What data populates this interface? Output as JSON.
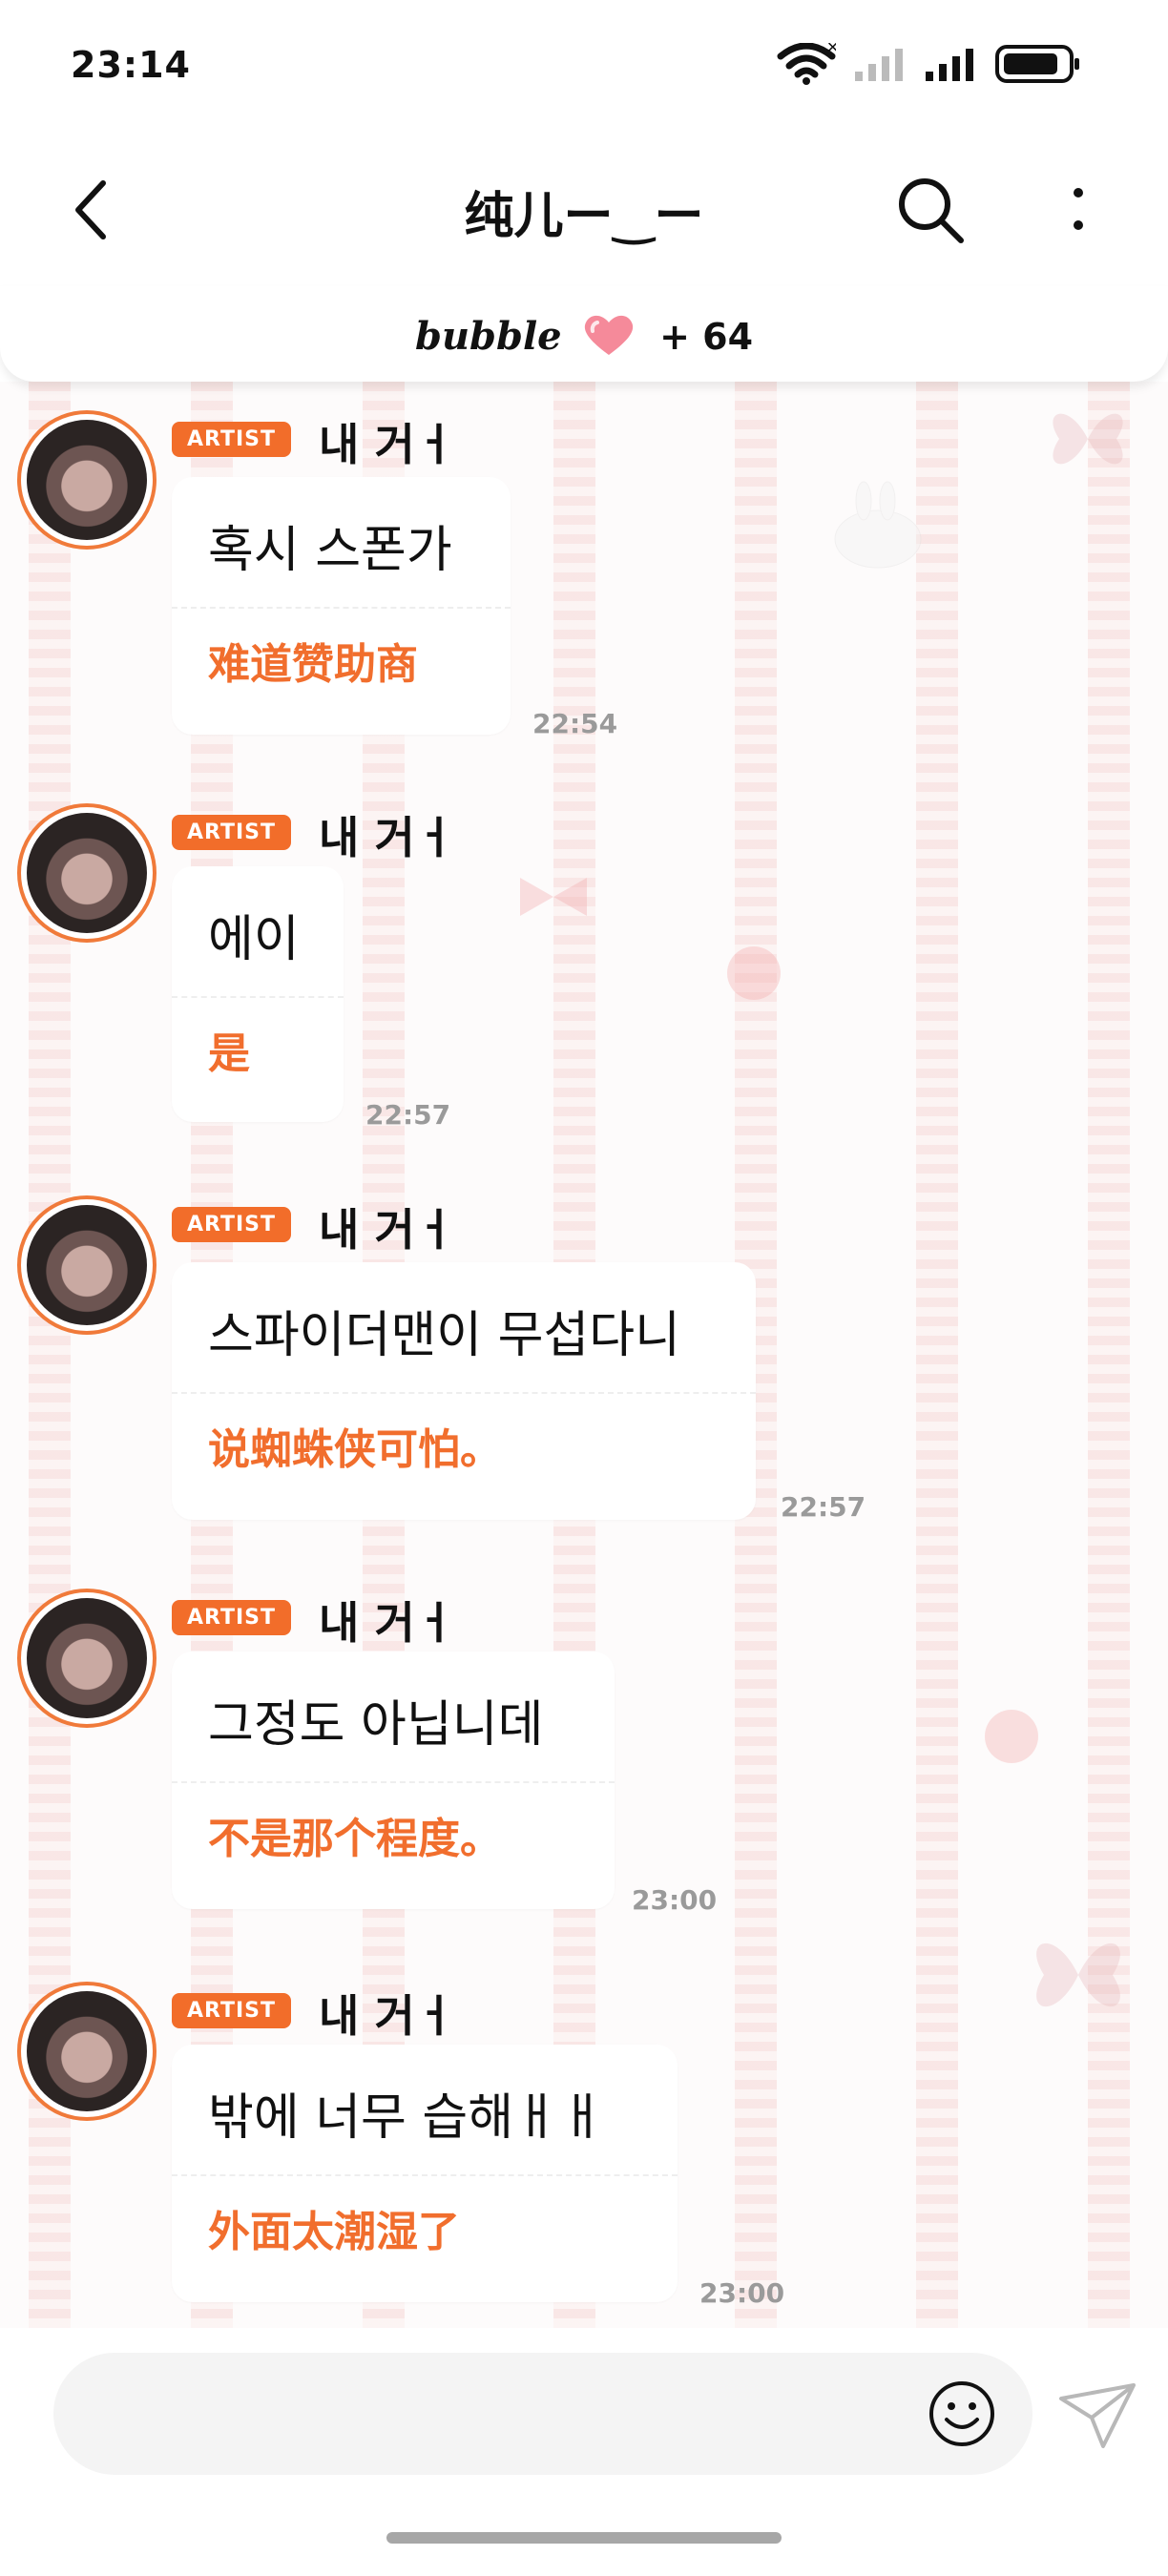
{
  "status": {
    "time": "23:14"
  },
  "header": {
    "title": "纯儿ー‿ー"
  },
  "bubble_bar": {
    "logo": "bubble",
    "count": "+ 64"
  },
  "messages": [
    {
      "badge": "ARTIST",
      "sender": "내 거ㅓ",
      "korean": "혹시 스폰가",
      "chinese": "难道赞助商",
      "time": "22:54"
    },
    {
      "badge": "ARTIST",
      "sender": "내 거ㅓ",
      "korean": "에이",
      "chinese": "是",
      "time": "22:57"
    },
    {
      "badge": "ARTIST",
      "sender": "내 거ㅓ",
      "korean": "스파이더맨이 무섭다니",
      "chinese": "说蜘蛛侠可怕。",
      "time": "22:57"
    },
    {
      "badge": "ARTIST",
      "sender": "내 거ㅓ",
      "korean": "그정도 아닙니데",
      "chinese": "不是那个程度。",
      "time": "23:00"
    },
    {
      "badge": "ARTIST",
      "sender": "내 거ㅓ",
      "korean": "밖에 너무 습해ㅐㅐ",
      "chinese": "外面太潮湿了",
      "time": "23:00"
    }
  ],
  "colors": {
    "accent": "#f26d2a",
    "bubble": "#ffffff",
    "time": "#9a9a9a"
  },
  "icons": [
    "back-arrow-icon",
    "search-icon",
    "more-vertical-icon",
    "heart-icon",
    "wifi-icon",
    "signal-icon",
    "battery-icon",
    "emoji-icon",
    "send-icon"
  ]
}
